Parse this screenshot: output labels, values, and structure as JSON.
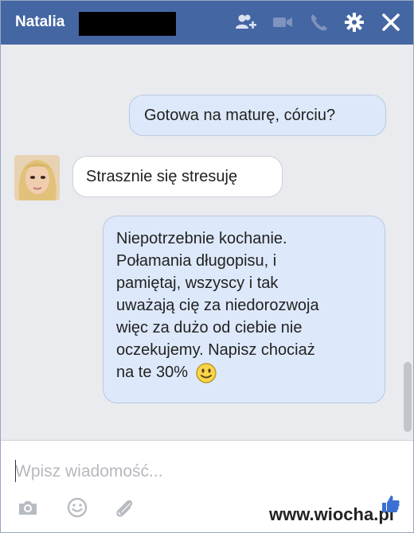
{
  "header": {
    "contact_name": "Natalia",
    "icons": [
      "add-person-icon",
      "video-call-icon",
      "phone-icon",
      "gear-icon",
      "close-icon"
    ]
  },
  "messages": [
    {
      "sender": "me",
      "text": "Gotowa na maturę, córciu?"
    },
    {
      "sender": "Natalia",
      "text": "Strasznie się stresuję"
    },
    {
      "sender": "me",
      "lines": [
        "Niepotrzebnie kochanie.",
        "Połamania długopisu, i",
        "pamiętaj, wszyscy i tak",
        "uważają cię za niedorozwoja",
        "więc za dużo od ciebie nie",
        "oczekujemy. Napisz chociaż",
        "na te 30%"
      ],
      "emoji": "smiley-icon"
    }
  ],
  "composer": {
    "placeholder": "Wpisz wiadomość...",
    "icons": [
      "camera-icon",
      "emoji-icon",
      "paperclip-icon"
    ]
  },
  "watermark": {
    "text": "www.wiocha.pl"
  },
  "colors": {
    "header_bg": "#4466a3",
    "message_area_bg": "#e9ebee",
    "outgoing_bubble": "#dde9fa",
    "incoming_bubble": "#ffffff"
  }
}
